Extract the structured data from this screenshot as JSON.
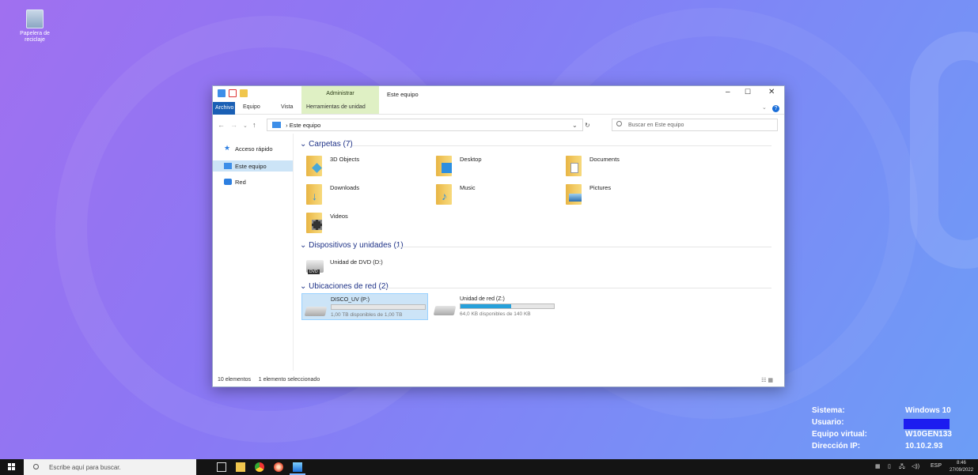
{
  "desktop": {
    "recycle_bin_label": "Papelera de reciclaje",
    "info": [
      {
        "key": "Sistema:",
        "value": "Windows 10"
      },
      {
        "key": "Usuario:",
        "value": ""
      },
      {
        "key": "Equipo virtual:",
        "value": "W10GEN133"
      },
      {
        "key": "Dirección IP:",
        "value": "10.10.2.93"
      }
    ]
  },
  "window": {
    "title": "Este equipo",
    "context_tab": "Administrar",
    "ribbon_tabs": [
      "Archivo",
      "Equipo",
      "Vista",
      "Herramientas de unidad"
    ],
    "address": "Este equipo",
    "search_placeholder": "Buscar en Este equipo",
    "sidebar": [
      {
        "label": "Acceso rápido",
        "icon": "star-icon"
      },
      {
        "label": "Este equipo",
        "icon": "computer-icon",
        "selected": true
      },
      {
        "label": "Red",
        "icon": "network-icon"
      }
    ],
    "groups": {
      "folders": "Carpetas (7)",
      "devices": "Dispositivos y unidades (1)",
      "network": "Ubicaciones de red (2)"
    },
    "folders": [
      "3D Objects",
      "Desktop",
      "Documents",
      "Downloads",
      "Music",
      "Pictures",
      "Videos"
    ],
    "dvd_label": "Unidad de DVD (D:)",
    "dvd_badge": "DVD",
    "drives": [
      {
        "name": "DISCO_UV (P:)",
        "free": "1,00 TB disponibles de 1,00 TB",
        "used_fraction": 0.0,
        "selected": true
      },
      {
        "name": "Unidad de red (Z:)",
        "free": "64,0 KB disponibles de 140 KB",
        "used_fraction": 0.54,
        "selected": false
      }
    ],
    "status_items": "10 elementos",
    "status_selected": "1 elemento seleccionado"
  },
  "taskbar": {
    "search_placeholder": "Escribe aquí para buscar.",
    "lang": "ESP",
    "time": "8:46",
    "date": "27/09/2022"
  },
  "colors": {
    "accent": "#26a0da",
    "file_tab": "#1a5fb4",
    "selection": "#cce4f7"
  }
}
